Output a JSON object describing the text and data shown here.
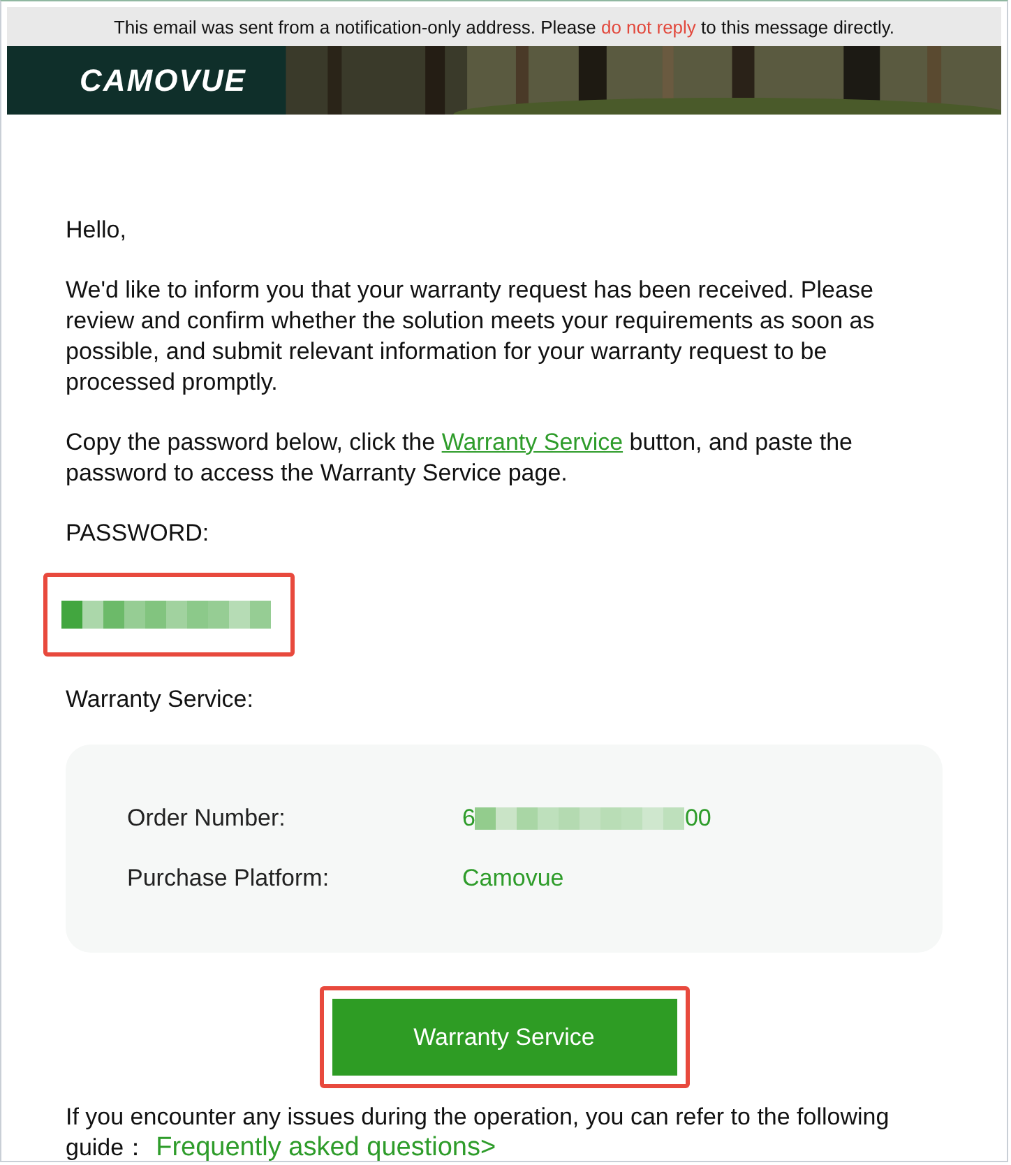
{
  "notice": {
    "before": "This email was sent from a notification-only address. Please",
    "link": "do not reply",
    "after": "to this message directly."
  },
  "banner": {
    "logo": "CAMOVUE",
    "kind": "picture"
  },
  "greeting": "Hello,",
  "paragraph_1": "We'd like to inform you that your warranty request has been received. Please review and confirm whether the solution meets your requirements as soon as possible, and submit relevant information for your warranty request to be processed promptly.",
  "paragraph_2": {
    "before": "Copy the password below, click the",
    "link": "Warranty Service",
    "after": "button, and paste the password to access the Warranty Service page."
  },
  "password_label": "PASSWORD:",
  "password": {
    "redacted": true,
    "highlighted": true
  },
  "service_label": "Warranty Service:",
  "details": [
    {
      "label": "Order Number:",
      "value_start": "6",
      "value_end": "00",
      "redacted": true
    },
    {
      "label": "Purchase Platform:",
      "value_start": "Camovue",
      "redacted": false
    }
  ],
  "button": {
    "label": "Warranty Service",
    "highlighted": true
  },
  "footer": {
    "text": "If you encounter any issues during the operation, you can refer to the following guide：",
    "link": "Frequently asked questions>"
  }
}
